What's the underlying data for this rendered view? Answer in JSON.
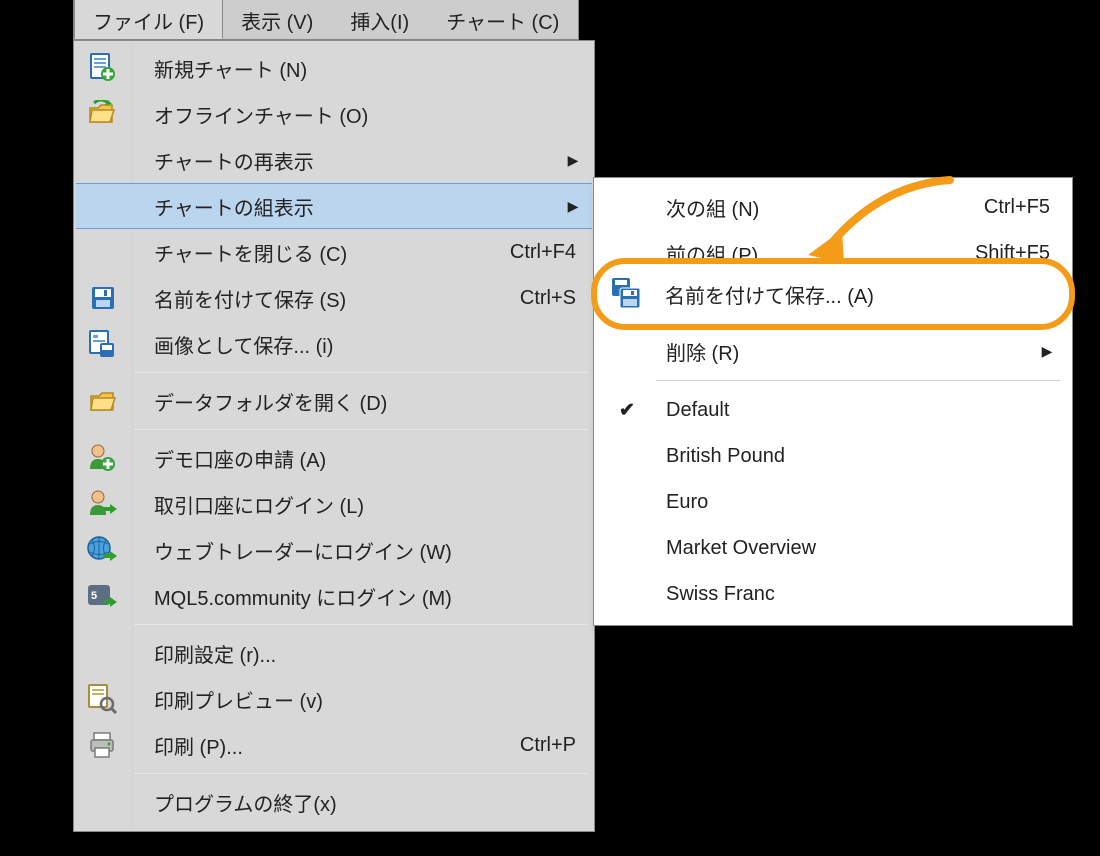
{
  "menubar": {
    "items": [
      {
        "label": "ファイル (F)",
        "active": true
      },
      {
        "label": "表示 (V)",
        "active": false
      },
      {
        "label": "挿入(I)",
        "active": false
      },
      {
        "label": "チャート (C)",
        "active": false
      }
    ]
  },
  "file_menu": {
    "items": [
      {
        "icon": "doc-plus",
        "label": "新規チャート (N)",
        "shortcut": "",
        "submenu": false
      },
      {
        "icon": "folder-open-green",
        "label": "オフラインチャート (O)",
        "shortcut": "",
        "submenu": false
      },
      {
        "icon": "",
        "label": "チャートの再表示",
        "shortcut": "",
        "submenu": true
      },
      {
        "icon": "",
        "label": "チャートの組表示",
        "shortcut": "",
        "submenu": true,
        "highlighted": true
      },
      {
        "icon": "",
        "label": "チャートを閉じる (C)",
        "shortcut": "Ctrl+F4",
        "submenu": false
      },
      {
        "icon": "floppy",
        "label": "名前を付けて保存 (S)",
        "shortcut": "Ctrl+S",
        "submenu": false
      },
      {
        "icon": "floppy-img",
        "label": "画像として保存... (i)",
        "shortcut": "",
        "submenu": false
      },
      {
        "sep": true
      },
      {
        "icon": "folder-open",
        "label": "データフォルダを開く (D)",
        "shortcut": "",
        "submenu": false
      },
      {
        "sep": true
      },
      {
        "icon": "person-plus",
        "label": "デモ口座の申請 (A)",
        "shortcut": "",
        "submenu": false
      },
      {
        "icon": "person-arrow",
        "label": "取引口座にログイン (L)",
        "shortcut": "",
        "submenu": false
      },
      {
        "icon": "globe-arrow",
        "label": "ウェブトレーダーにログイン (W)",
        "shortcut": "",
        "submenu": false
      },
      {
        "icon": "mql-badge",
        "label": "MQL5.community にログイン (M)",
        "shortcut": "",
        "submenu": false
      },
      {
        "sep": true
      },
      {
        "icon": "",
        "label": "印刷設定 (r)...",
        "shortcut": "",
        "submenu": false
      },
      {
        "icon": "doc-preview",
        "label": "印刷プレビュー (v)",
        "shortcut": "",
        "submenu": false
      },
      {
        "icon": "printer",
        "label": "印刷 (P)...",
        "shortcut": "Ctrl+P",
        "submenu": false
      },
      {
        "sep": true
      },
      {
        "icon": "",
        "label": "プログラムの終了(x)",
        "shortcut": "",
        "submenu": false
      }
    ]
  },
  "submenu": {
    "items": [
      {
        "icon": "",
        "label": "次の組 (N)",
        "shortcut": "Ctrl+F5"
      },
      {
        "icon": "",
        "label": "前の組 (P)",
        "shortcut": "Shift+F5"
      },
      {
        "icon": "floppy-dual",
        "label": "名前を付けて保存... (A)",
        "shortcut": "",
        "callout": true
      },
      {
        "icon": "",
        "label": "削除 (R)",
        "shortcut": "",
        "submenu": true
      },
      {
        "sep": true
      },
      {
        "check": true,
        "label": "Default"
      },
      {
        "check": false,
        "label": "British Pound"
      },
      {
        "check": false,
        "label": "Euro"
      },
      {
        "check": false,
        "label": "Market Overview"
      },
      {
        "check": false,
        "label": "Swiss Franc"
      }
    ]
  }
}
